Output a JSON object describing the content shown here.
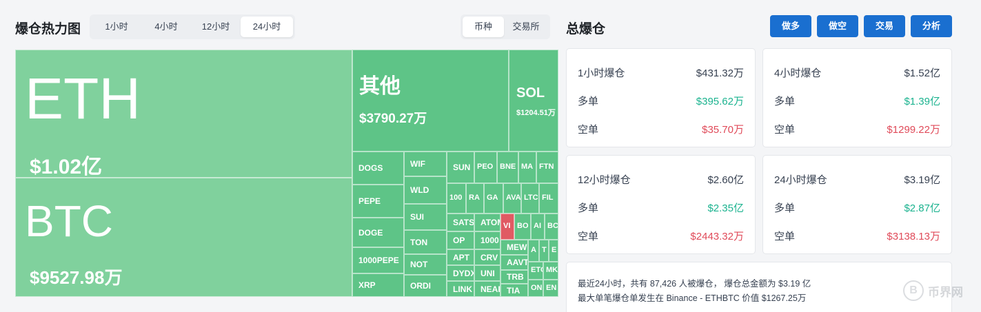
{
  "heatmap": {
    "title": "爆仓热力图",
    "time_tabs": [
      "1小时",
      "4小时",
      "12小时",
      "24小时"
    ],
    "time_active": "24小时",
    "type_tabs": [
      "币种",
      "交易所"
    ],
    "type_active": "币种",
    "cells": [
      {
        "id": "eth",
        "sym": "ETH",
        "val": "$1.02亿"
      },
      {
        "id": "btc",
        "sym": "BTC",
        "val": "$9527.98万"
      },
      {
        "id": "other",
        "sym": "其他",
        "val": "$3790.27万"
      },
      {
        "id": "sol",
        "sym": "SOL",
        "val": "$1204.51万"
      },
      {
        "id": "dogs",
        "sym": "DOGS"
      },
      {
        "id": "pepe",
        "sym": "PEPE"
      },
      {
        "id": "doge",
        "sym": "DOGE"
      },
      {
        "id": "1000pepe",
        "sym": "1000PEPE"
      },
      {
        "id": "xrp",
        "sym": "XRP"
      },
      {
        "id": "wif",
        "sym": "WIF"
      },
      {
        "id": "wld",
        "sym": "WLD"
      },
      {
        "id": "sui",
        "sym": "SUI"
      },
      {
        "id": "ton",
        "sym": "TON"
      },
      {
        "id": "not",
        "sym": "NOT"
      },
      {
        "id": "ordi",
        "sym": "ORDI"
      },
      {
        "id": "sun",
        "sym": "SUN"
      },
      {
        "id": "peo",
        "sym": "PEO"
      },
      {
        "id": "bne",
        "sym": "BNE"
      },
      {
        "id": "ma",
        "sym": "MA"
      },
      {
        "id": "ftn",
        "sym": "FTN"
      },
      {
        "id": "100",
        "sym": "100"
      },
      {
        "id": "ra",
        "sym": "RA"
      },
      {
        "id": "ga",
        "sym": "GA"
      },
      {
        "id": "ava",
        "sym": "AVA"
      },
      {
        "id": "ltc",
        "sym": "LTC"
      },
      {
        "id": "fil",
        "sym": "FIL"
      },
      {
        "id": "sats",
        "sym": "SATS"
      },
      {
        "id": "atom",
        "sym": "ATOM"
      },
      {
        "id": "op",
        "sym": "OP"
      },
      {
        "id": "1000",
        "sym": "1000"
      },
      {
        "id": "apt",
        "sym": "APT"
      },
      {
        "id": "crv",
        "sym": "CRV"
      },
      {
        "id": "dydx",
        "sym": "DYDX"
      },
      {
        "id": "uni",
        "sym": "UNI"
      },
      {
        "id": "link",
        "sym": "LINK"
      },
      {
        "id": "near",
        "sym": "NEAR"
      },
      {
        "id": "vi",
        "sym": "VI"
      },
      {
        "id": "bo",
        "sym": "BO"
      },
      {
        "id": "ai",
        "sym": "AI"
      },
      {
        "id": "bc",
        "sym": "BC"
      },
      {
        "id": "mew",
        "sym": "MEW"
      },
      {
        "id": "aavt",
        "sym": "AAVT"
      },
      {
        "id": "trb",
        "sym": "TRB"
      },
      {
        "id": "tia",
        "sym": "TIA"
      },
      {
        "id": "a",
        "sym": "A"
      },
      {
        "id": "t",
        "sym": "T"
      },
      {
        "id": "e",
        "sym": "E"
      },
      {
        "id": "etc",
        "sym": "ETC"
      },
      {
        "id": "mk",
        "sym": "MK"
      },
      {
        "id": "on",
        "sym": "ON"
      },
      {
        "id": "en",
        "sym": "EN"
      }
    ]
  },
  "total": {
    "title": "总爆仓",
    "buttons": [
      "做多",
      "做空",
      "交易",
      "分析"
    ],
    "cards": [
      {
        "title": "1小时爆仓",
        "total": "$431.32万",
        "long_label": "多单",
        "long": "$395.62万",
        "short_label": "空单",
        "short": "$35.70万"
      },
      {
        "title": "4小时爆仓",
        "total": "$1.52亿",
        "long_label": "多单",
        "long": "$1.39亿",
        "short_label": "空单",
        "short": "$1299.22万"
      },
      {
        "title": "12小时爆仓",
        "total": "$2.60亿",
        "long_label": "多单",
        "long": "$2.35亿",
        "short_label": "空单",
        "short": "$2443.32万"
      },
      {
        "title": "24小时爆仓",
        "total": "$3.19亿",
        "long_label": "多单",
        "long": "$2.87亿",
        "short_label": "空单",
        "short": "$3138.13万"
      }
    ],
    "summary_line1": "最近24小时，共有 87,426 人被爆仓， 爆仓总金额为 $3.19 亿",
    "summary_line2": "最大单笔爆仓单发生在 Binance - ETHBTC 价值 $1267.25万"
  },
  "watermark": {
    "text": "币界网",
    "coin": "B"
  },
  "colors": {
    "accent": "#1a6fd0",
    "tile": "#5ec487",
    "tile_big": "#80d19d",
    "tile_loss": "#e05a63",
    "long": "#1bb38f",
    "short": "#e04a59"
  }
}
